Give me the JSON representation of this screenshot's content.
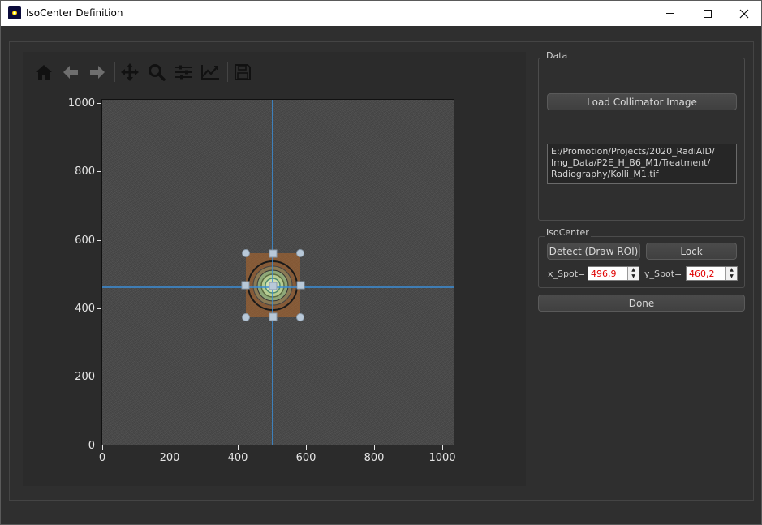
{
  "window": {
    "title": "IsoCenter Definition"
  },
  "toolbar": {
    "items": [
      "home-icon",
      "back-icon",
      "forward-icon",
      "pan-icon",
      "zoom-icon",
      "configure-subplots-icon",
      "edit-axis-icon",
      "save-icon"
    ]
  },
  "plot": {
    "yticks": [
      "1000",
      "800",
      "600",
      "400",
      "200",
      "0"
    ],
    "xticks": [
      "0",
      "200",
      "400",
      "600",
      "800",
      "1000"
    ],
    "crosshair_x": 496.9,
    "crosshair_y": 460.2,
    "colors": {
      "crosshair": "#3b8ed8",
      "roi_fill": "#c8641e",
      "handle": "#b8c8d8"
    }
  },
  "data_group": {
    "title": "Data",
    "load_button": "Load Collimator Image",
    "path_lines": [
      "E:/Promotion/Projects/2020_RadiAID/",
      "Img_Data/P2E_H_B6_M1/Treatment/",
      "Radiography/Kolli_M1.tif"
    ]
  },
  "isocenter_group": {
    "title": "IsoCenter",
    "detect_button": "Detect (Draw ROI)",
    "lock_button": "Lock",
    "x_label": "x_Spot=",
    "x_value": "496,9",
    "y_label": "y_Spot=",
    "y_value": "460,2"
  },
  "done_button": "Done"
}
